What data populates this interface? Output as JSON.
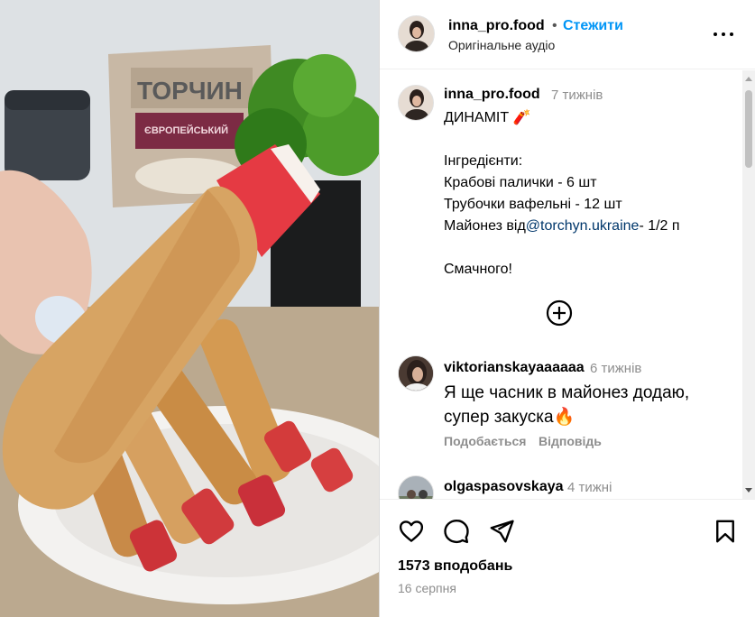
{
  "post": {
    "username": "inna_pro.food",
    "separator": "•",
    "follow_label": "Стежити",
    "audio_label": "Оригінальне аудіо"
  },
  "caption": {
    "username": "inna_pro.food",
    "time": "7 тижнів",
    "title": "ДИНАМІТ 🧨",
    "lines": [
      "",
      "Інгредієнти:",
      "Крабові палички - 6 шт",
      "Трубочки вафельні - 12 шт"
    ],
    "mayo_prefix": "Майонез від",
    "mayo_link": "@torchyn.ukraine",
    "mayo_suffix": "- 1/2 п",
    "closing": "Смачного!"
  },
  "comments": [
    {
      "username": "viktorianskayaaaaaa",
      "time": "6 тижнів",
      "text": "Я ще часник в майонез додаю, супер закуска🔥",
      "likes_label": "Подобається",
      "reply_label": "Відповідь"
    },
    {
      "username": "olgaspasovskaya",
      "time": "4 тижні"
    }
  ],
  "footer": {
    "likes": "1573 вподобань",
    "date": "16 серпня"
  },
  "media": {
    "package_brand": "ТОРЧИН",
    "package_sub": "ЄВРОПЕЙСЬКИЙ"
  },
  "colors": {
    "accent": "#0095f6",
    "link": "#00376b",
    "muted": "#8e8e8e"
  },
  "icons": [
    "more-icon",
    "add-comment-icon",
    "heart-icon",
    "comment-icon",
    "share-icon",
    "bookmark-icon"
  ]
}
